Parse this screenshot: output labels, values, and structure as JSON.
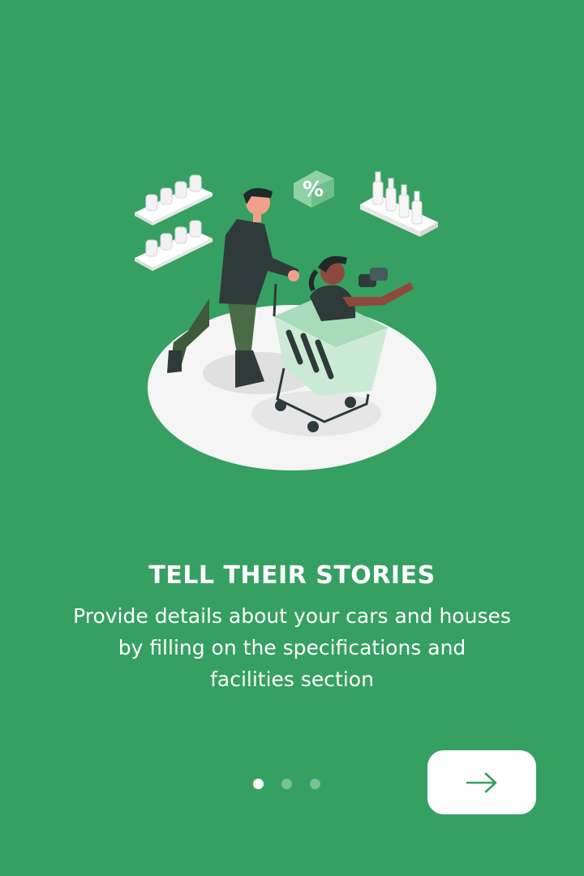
{
  "onboarding": {
    "title": "TELL THEIR STORIES",
    "description": "Provide details about your cars and houses by filling on the specifications and facilities section",
    "illustration_badge": "%",
    "page_indicator": {
      "total": 3,
      "active_index": 0
    },
    "next_button_icon": "arrow-right-icon"
  },
  "colors": {
    "background": "#35a062",
    "text": "#ffffff",
    "button_bg": "#ffffff",
    "button_icon": "#35a062"
  }
}
